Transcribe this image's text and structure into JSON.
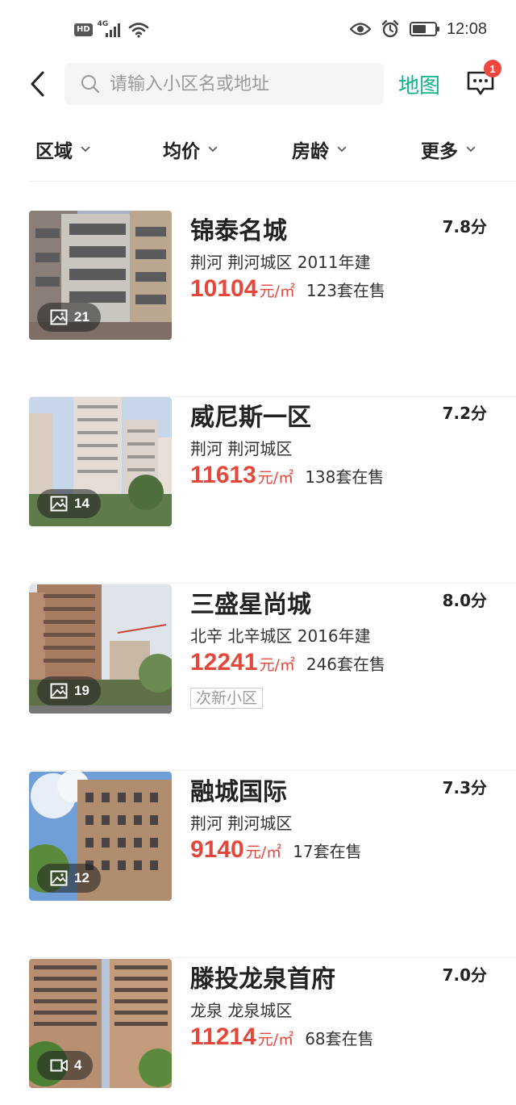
{
  "status_bar": {
    "hd": "HD",
    "network": "4G",
    "time": "12:08"
  },
  "header": {
    "search_placeholder": "请输入小区名或地址",
    "map_label": "地图",
    "message_badge": "1"
  },
  "filters": [
    {
      "label": "区域"
    },
    {
      "label": "均价"
    },
    {
      "label": "房龄"
    },
    {
      "label": "更多"
    }
  ],
  "communities": [
    {
      "name": "锦泰名城",
      "score": "7.8分",
      "location": "荆河  荆河城区  2011年建",
      "price": "10104",
      "unit": "元/㎡",
      "on_sale": "123套在售",
      "media_count": "21",
      "media_type": "photo-icon",
      "tag": ""
    },
    {
      "name": "威尼斯一区",
      "score": "7.2分",
      "location": "荆河  荆河城区",
      "price": "11613",
      "unit": "元/㎡",
      "on_sale": "138套在售",
      "media_count": "14",
      "media_type": "photo-icon",
      "tag": ""
    },
    {
      "name": "三盛星尚城",
      "score": "8.0分",
      "location": "北辛  北辛城区  2016年建",
      "price": "12241",
      "unit": "元/㎡",
      "on_sale": "246套在售",
      "media_count": "19",
      "media_type": "photo-icon",
      "tag": "次新小区"
    },
    {
      "name": "融城国际",
      "score": "7.3分",
      "location": "荆河  荆河城区",
      "price": "9140",
      "unit": "元/㎡",
      "on_sale": "17套在售",
      "media_count": "12",
      "media_type": "photo-icon",
      "tag": ""
    },
    {
      "name": "滕投龙泉首府",
      "score": "7.0分",
      "location": "龙泉  龙泉城区",
      "price": "11214",
      "unit": "元/㎡",
      "on_sale": "68套在售",
      "media_count": "4",
      "media_type": "video-icon",
      "tag": ""
    }
  ],
  "colors": {
    "accent_green": "#12b28a",
    "price_red": "#e5483b",
    "badge_red": "#f0483e"
  }
}
